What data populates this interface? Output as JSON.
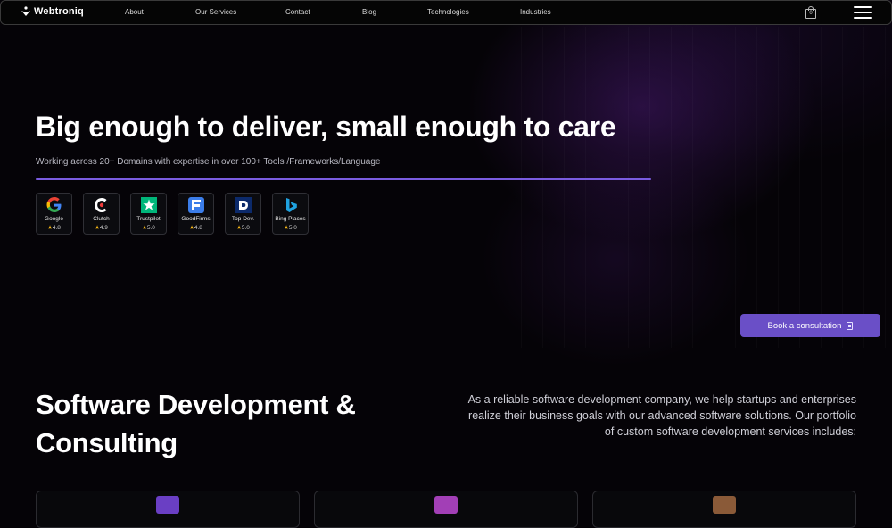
{
  "nav": {
    "logo_text": "Webtroniq",
    "links": [
      "About",
      "Our Services",
      "Contact",
      "Blog",
      "Technologies",
      "Industries"
    ],
    "cart_count": "0",
    "cart_icon": "shopping-bag-icon",
    "menu_icon": "hamburger-menu-icon"
  },
  "hero": {
    "title": "Big enough to deliver, small enough to care",
    "subtitle": "Working across 20+ Domains with expertise in over 100+ Tools /Frameworks/Language",
    "accent_color": "#7a5ce0",
    "badges": [
      {
        "name": "Google",
        "rating": "4.8",
        "icon": "google-icon"
      },
      {
        "name": "Clutch",
        "rating": "4.9",
        "icon": "clutch-icon"
      },
      {
        "name": "Trustpilot",
        "rating": "5.0",
        "icon": "trustpilot-icon"
      },
      {
        "name": "GoodFirms",
        "rating": "4.8",
        "icon": "goodfirms-icon"
      },
      {
        "name": "Top Dev.",
        "rating": "5.0",
        "icon": "top-dev-icon"
      },
      {
        "name": "Bing Places",
        "rating": "5.0",
        "icon": "bing-icon"
      }
    ],
    "star_glyph": "★",
    "cta_label": "Book a consultation",
    "cta_color": "#6a4fc7"
  },
  "services": {
    "title": "Software Development & Consulting",
    "description": "As a reliable software development company, we help startups and enterprises realize their business goals with our advanced software solutions. Our portfolio of custom software development services includes:",
    "card_icon_colors": [
      "#6a3fc4",
      "#a23fb6",
      "#8a5a38"
    ]
  }
}
